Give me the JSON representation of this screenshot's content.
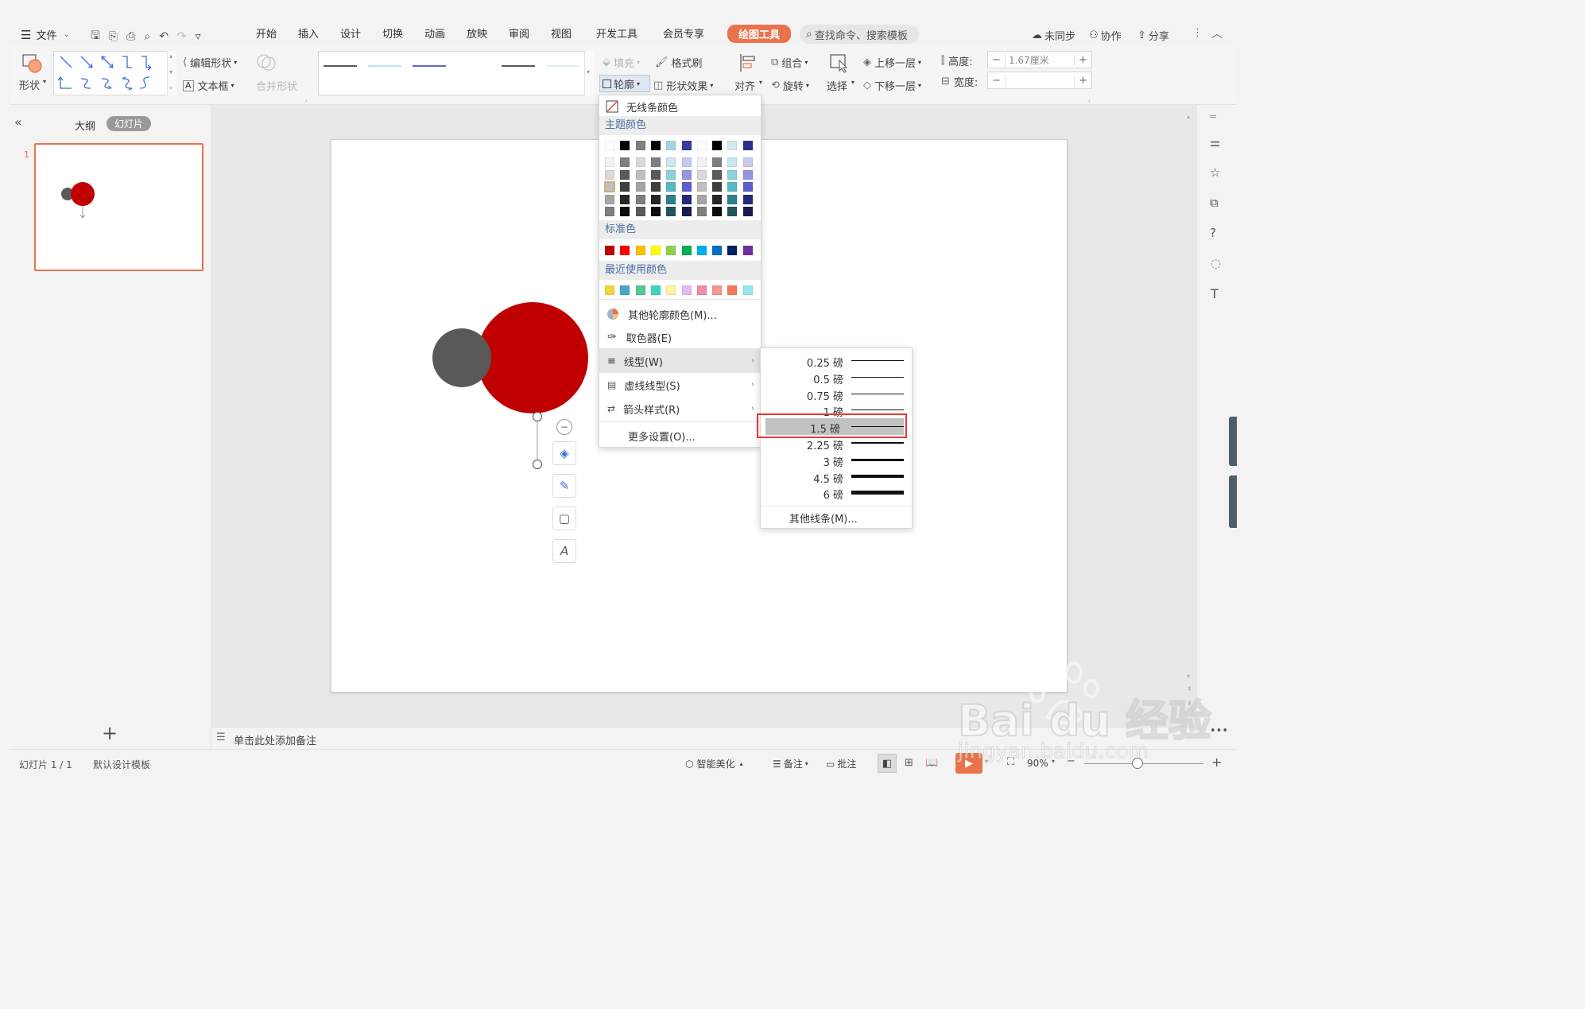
{
  "menubar": {
    "file_label": "文件",
    "tabs": [
      "开始",
      "插入",
      "设计",
      "切换",
      "动画",
      "放映",
      "审阅",
      "视图",
      "开发工具",
      "会员专享",
      "绘图工具"
    ],
    "active_tab": "绘图工具",
    "search_placeholder": "查找命令、搜索模板",
    "sync_label": "未同步",
    "collab_label": "协作",
    "share_label": "分享"
  },
  "ribbon": {
    "shape_label": "形状",
    "edit_shape": "编辑形状",
    "textbox": "文本框",
    "merge_shape": "合并形状",
    "fill": "填充",
    "format_painter": "格式刷",
    "outline": "轮廓",
    "shape_effect": "形状效果",
    "align": "对齐",
    "group": "组合",
    "rotate": "旋转",
    "select": "选择",
    "bring_forward": "上移一层",
    "send_backward": "下移一层",
    "height_label": "高度:",
    "height_value": "1.67厘米",
    "width_label": "宽度:",
    "width_value": "",
    "minus": "−",
    "plus": "+"
  },
  "left_pane": {
    "outline_tab": "大纲",
    "slides_tab": "幻灯片",
    "slide_number": "1",
    "add_label": "+"
  },
  "outline_menu": {
    "no_line": "无线条颜色",
    "theme_colors_title": "主题颜色",
    "theme_top_row": [
      "#ffffff",
      "#000000",
      "#7f7f7f",
      "#000000",
      "#a5d6dd",
      "#3b3ba0",
      "#ffffff",
      "#000000",
      "#d5eaee",
      "#2e2e8c"
    ],
    "theme_shades": [
      [
        "#f2f2f2",
        "#7f7f7f",
        "#d9d9d9",
        "#7f7f7f",
        "#c7e8ec",
        "#c9c9ef",
        "#f2f2f2",
        "#7f7f7f",
        "#c7e8ec",
        "#c9c9ef"
      ],
      [
        "#d9d9d9",
        "#595959",
        "#bfbfbf",
        "#595959",
        "#8fd1d9",
        "#9494df",
        "#d9d9d9",
        "#595959",
        "#8fd1d9",
        "#9494df"
      ],
      [
        "#bfbfbf",
        "#3f3f3f",
        "#a6a6a6",
        "#3f3f3f",
        "#56bac6",
        "#5e5ecf",
        "#bfbfbf",
        "#3f3f3f",
        "#56bac6",
        "#5e5ecf"
      ],
      [
        "#a6a6a6",
        "#262626",
        "#7f7f7f",
        "#262626",
        "#2e7f89",
        "#27277a",
        "#a6a6a6",
        "#262626",
        "#2e7f89",
        "#27277a"
      ],
      [
        "#7f7f7f",
        "#0c0c0c",
        "#595959",
        "#0c0c0c",
        "#1f555b",
        "#1a1a51",
        "#7f7f7f",
        "#0c0c0c",
        "#1f555b",
        "#1a1a51"
      ]
    ],
    "standard_colors_title": "标准色",
    "standard_colors": [
      "#c00000",
      "#ff0000",
      "#ffc000",
      "#ffff00",
      "#92d050",
      "#00b050",
      "#00b0f0",
      "#0070c0",
      "#002060",
      "#7030a0"
    ],
    "recent_colors_title": "最近使用颜色",
    "recent_colors": [
      "#f0d83c",
      "#4aa6c6",
      "#54c896",
      "#3ed6c0",
      "#fff59a",
      "#e9b8f0",
      "#f08caa",
      "#f4978e",
      "#f47a5a",
      "#9ae6ee"
    ],
    "more_colors": "其他轮廓颜色(M)...",
    "eyedropper": "取色器(E)",
    "line_style": "线型(W)",
    "dash_style": "虚线线型(S)",
    "arrow_style": "箭头样式(R)",
    "more_settings": "更多设置(O)..."
  },
  "weight_menu": {
    "weights": [
      {
        "label": "0.25 磅",
        "pt": 0.25
      },
      {
        "label": "0.5 磅",
        "pt": 0.5
      },
      {
        "label": "0.75 磅",
        "pt": 0.75
      },
      {
        "label": "1 磅",
        "pt": 1
      },
      {
        "label": "1.5 磅",
        "pt": 1.5
      },
      {
        "label": "2.25 磅",
        "pt": 2.25
      },
      {
        "label": "3 磅",
        "pt": 3
      },
      {
        "label": "4.5 磅",
        "pt": 4.5
      },
      {
        "label": "6 磅",
        "pt": 6
      }
    ],
    "selected": "1.5 磅",
    "more_lines": "其他线条(M)..."
  },
  "colors": {
    "accent": "#e9734c",
    "red_circle": "#c00000",
    "gray_circle": "#595959",
    "highlight_box": "#e53935"
  },
  "notes_placeholder": "单击此处添加备注",
  "statusbar": {
    "slide_info": "幻灯片 1 / 1",
    "template": "默认设计模板",
    "beautify": "智能美化",
    "notes": "备注",
    "comments": "批注",
    "zoom": "90%"
  },
  "watermark": {
    "text": "Bai du 经验",
    "url": "jingyan.baidu.com"
  }
}
